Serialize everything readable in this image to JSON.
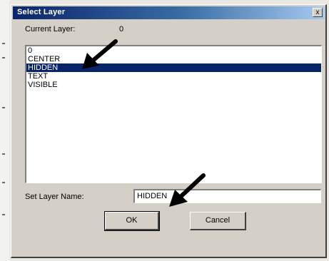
{
  "dialog": {
    "title": "Select Layer",
    "close_glyph": "x",
    "current_layer_label": "Current Layer:",
    "current_layer_value": "0",
    "layers": [
      "0",
      "CENTER",
      "HIDDEN",
      "TEXT",
      "VISIBLE"
    ],
    "selected_layer": "HIDDEN",
    "set_layer_name_label": "Set Layer Name:",
    "set_layer_name_value": "HIDDEN",
    "ok_label": "OK",
    "cancel_label": "Cancel"
  },
  "annotations": {
    "arrow_color": "#000000",
    "arrow_icon": "black-arrow-icon"
  },
  "colors": {
    "selection": "#0a246a",
    "dialog_face": "#d4d0c8",
    "title_start": "#0a246a",
    "title_end": "#a6caf0"
  }
}
